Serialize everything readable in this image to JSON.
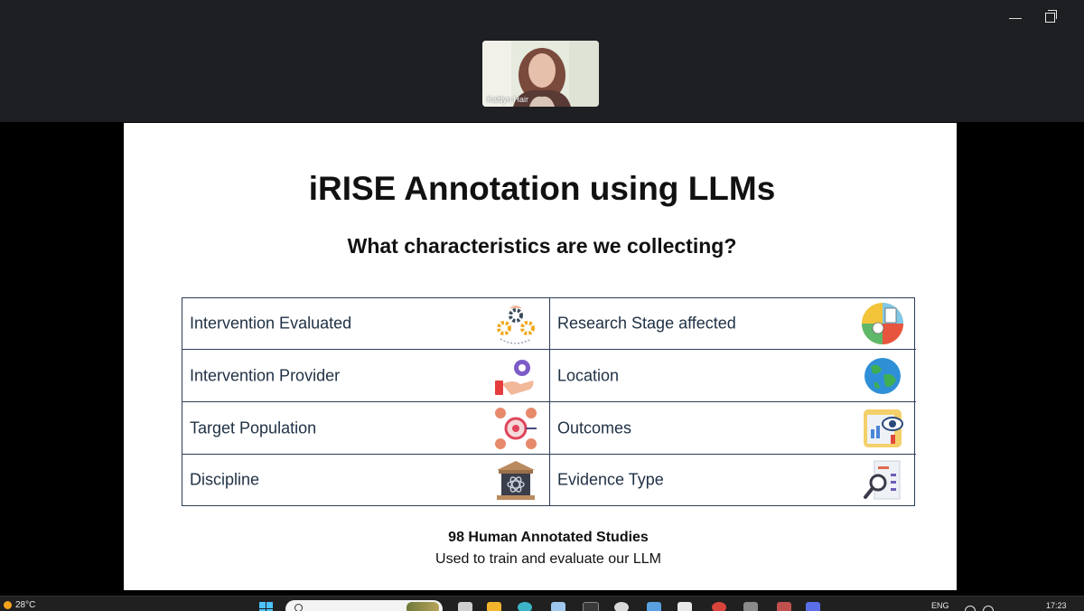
{
  "meeting": {
    "participant_name": "Kaitlyn Hair",
    "window_controls": {
      "minimize_icon": "minimize-icon",
      "restore_icon": "restore-icon"
    }
  },
  "slide": {
    "title": "iRISE Annotation using LLMs",
    "subtitle": "What characteristics are we collecting?",
    "rows": [
      {
        "left": "Intervention Evaluated",
        "left_icon": "gears-hand-icon",
        "right": "Research Stage affected",
        "right_icon": "research-cycle-icon"
      },
      {
        "left": "Intervention Provider",
        "left_icon": "hand-gear-icon",
        "right": "Location",
        "right_icon": "globe-icon"
      },
      {
        "left": "Target Population",
        "left_icon": "target-people-icon",
        "right": "Outcomes",
        "right_icon": "eye-report-icon"
      },
      {
        "left": "Discipline",
        "left_icon": "academy-atom-icon",
        "right": "Evidence Type",
        "right_icon": "magnifier-document-icon"
      }
    ],
    "footer_bold": "98 Human Annotated Studies",
    "footer_text": "Used to train and evaluate our LLM"
  },
  "taskbar": {
    "temperature": "28°C",
    "language": "ENG",
    "time": "17:23"
  },
  "colors": {
    "grid_border": "#2c3e55",
    "label_text": "#1f3044",
    "topbar": "#1e1f22",
    "taskbar": "#202020"
  }
}
